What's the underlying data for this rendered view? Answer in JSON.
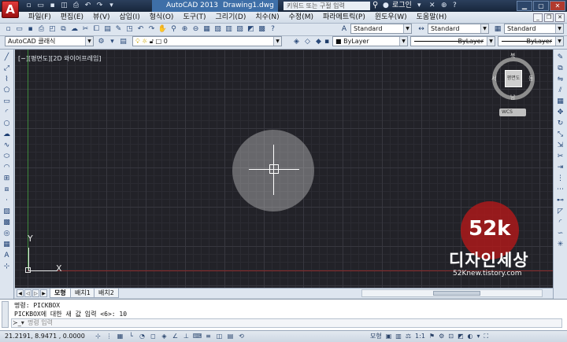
{
  "title_bar": {
    "app_logo_letter": "A",
    "app_name": "AutoCAD 2013",
    "file_name": "Drawing1.dwg",
    "search_placeholder": "키워드 또는 구절 입력",
    "login_label": "로그인",
    "quick_access_icons": [
      "new-icon",
      "open-icon",
      "save-icon",
      "saveas-icon",
      "print-icon",
      "undo-icon",
      "redo-icon",
      "dropdown-icon"
    ]
  },
  "menu": {
    "items": [
      "파일(F)",
      "편집(E)",
      "뷰(V)",
      "삽입(I)",
      "형식(O)",
      "도구(T)",
      "그리기(D)",
      "치수(N)",
      "수정(M)",
      "파라메트릭(P)",
      "윈도우(W)",
      "도움말(H)"
    ]
  },
  "toolbar2": {
    "workspace": "AutoCAD 클래식",
    "layer_value": "0",
    "text_style": "Standard",
    "dim_style": "Standard",
    "table_style": "Standard",
    "color": "ByLayer",
    "linetype": "ByLayer",
    "lineweight": "ByLayer"
  },
  "canvas": {
    "viewport_label": "[−][평면도][2D 와이어프레임]",
    "ucs_x": "X",
    "ucs_y": "Y",
    "viewcube": {
      "north": "북",
      "south": "남",
      "east": "동",
      "west": "서",
      "face": "평면도",
      "wcs_label": "WCS"
    },
    "watermark": {
      "number": "52k",
      "korean": "디자인세상",
      "url": "52Knew.tistory.com"
    },
    "colors": {
      "background": "#222228",
      "x_axis": "#8a2a2a",
      "y_axis": "#3d8a3d",
      "watermark": "#b41919"
    }
  },
  "layout_tabs": [
    "모형",
    "배치1",
    "배치2"
  ],
  "command": {
    "history": [
      "명령: PICKBOX",
      "PICKBOX에 대한 새 값 입력 <6>: 10"
    ],
    "placeholder": "명령 입력"
  },
  "status": {
    "coords": "21.2191, 8.9471 , 0.0000",
    "model_label": "모형",
    "scale_label": "1:1"
  }
}
